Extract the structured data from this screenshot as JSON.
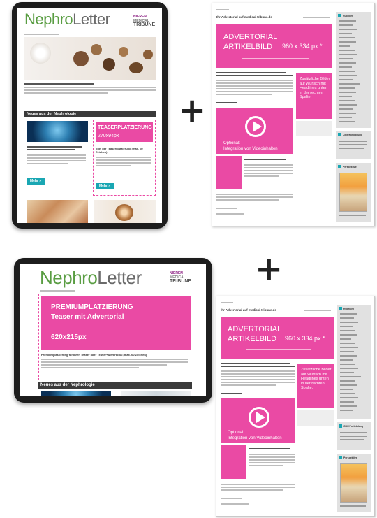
{
  "tablet1": {
    "logo_part1": "Nephro",
    "logo_part2": "Letter",
    "pub_line1": "NIEREN",
    "pub_line2": "MEDICAL",
    "pub_line3": "TRIBUNE",
    "section_heading": "Neues aus der Nephrologie",
    "teaser_label": "TEASERPLATZIERUNG",
    "teaser_size": "270x94px",
    "teaser_title": "Titel der Teaserplatzierung (max. 60 Zeichen)",
    "button1": "Mehr »",
    "button2": "Mehr »"
  },
  "tablet2": {
    "logo_part1": "Nephro",
    "logo_part2": "Letter",
    "pub_line1": "NIEREN",
    "pub_line2": "MEDICAL",
    "pub_line3": "TRIBUNE",
    "premium_title": "PREMIUMPLATZIERUNG",
    "premium_subtitle": "Teaser mit Advertorial",
    "premium_size": "620x215px",
    "premium_caption": "Premiumplatzierung für Ihren Teaser oder Teaser+Advertorial (max. 60 Zeichen)",
    "section_heading": "Neues aus der Nephrologie"
  },
  "page": {
    "title": "Ihr Advertorial auf medical-tribune.de",
    "hero_line1": "ADVERTORIAL",
    "hero_line2": "ARTIKELBILD",
    "hero_size": "960 x 334 px *",
    "side_box_text": "Zusätzliche Bilder auf Wunsch mit Headlines unten in der rechten Spalte.",
    "video_line1": "Optional:",
    "video_line2": "Integration von Videoinhalten",
    "sidebar_heading": "Rubriken",
    "sidebar_heading2": "CME/Fortbildung",
    "sidebar_heading3": "Perspektive"
  },
  "plus_sign": "+",
  "colors": {
    "accent_pink": "#ea4aa4",
    "logo_green": "#5a9d43",
    "button_teal": "#1aa7b3"
  }
}
